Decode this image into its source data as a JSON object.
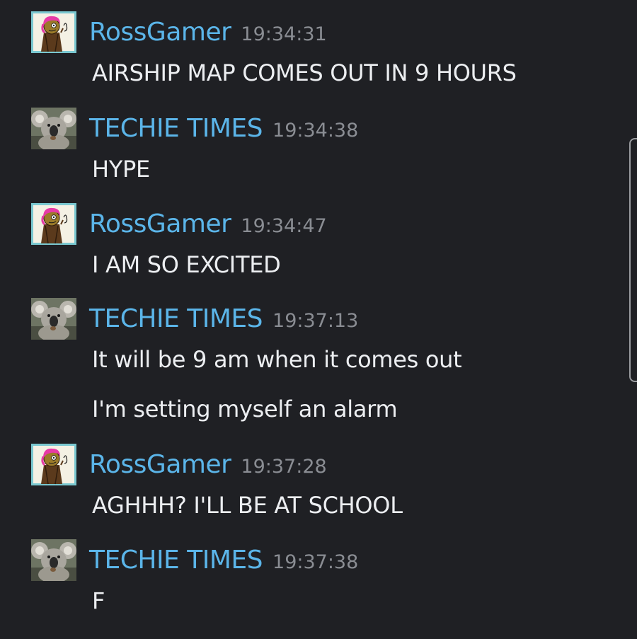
{
  "chat": {
    "messages": [
      {
        "author": "RossGamer",
        "avatar": "cartoon-avatar-icon",
        "time": "19:34:31",
        "lines": [
          "AIRSHIP MAP COMES OUT IN 9 HOURS"
        ]
      },
      {
        "author": "TECHIE TIMES",
        "avatar": "koala-avatar-icon",
        "time": "19:34:38",
        "lines": [
          "HYPE"
        ]
      },
      {
        "author": "RossGamer",
        "avatar": "cartoon-avatar-icon",
        "time": "19:34:47",
        "lines": [
          "I AM SO EXCITED"
        ]
      },
      {
        "author": "TECHIE TIMES",
        "avatar": "koala-avatar-icon",
        "time": "19:37:13",
        "lines": [
          "It will be 9 am when it comes out",
          "I'm setting myself an alarm"
        ]
      },
      {
        "author": "RossGamer",
        "avatar": "cartoon-avatar-icon",
        "time": "19:37:28",
        "lines": [
          "AGHHH? I'LL BE AT SCHOOL"
        ]
      },
      {
        "author": "TECHIE TIMES",
        "avatar": "koala-avatar-icon",
        "time": "19:37:38",
        "lines": [
          "F"
        ]
      }
    ]
  },
  "colors": {
    "background": "#1f2024",
    "author": "#5bb5e9",
    "timestamp": "#8a8d93",
    "text": "#eceef1"
  }
}
